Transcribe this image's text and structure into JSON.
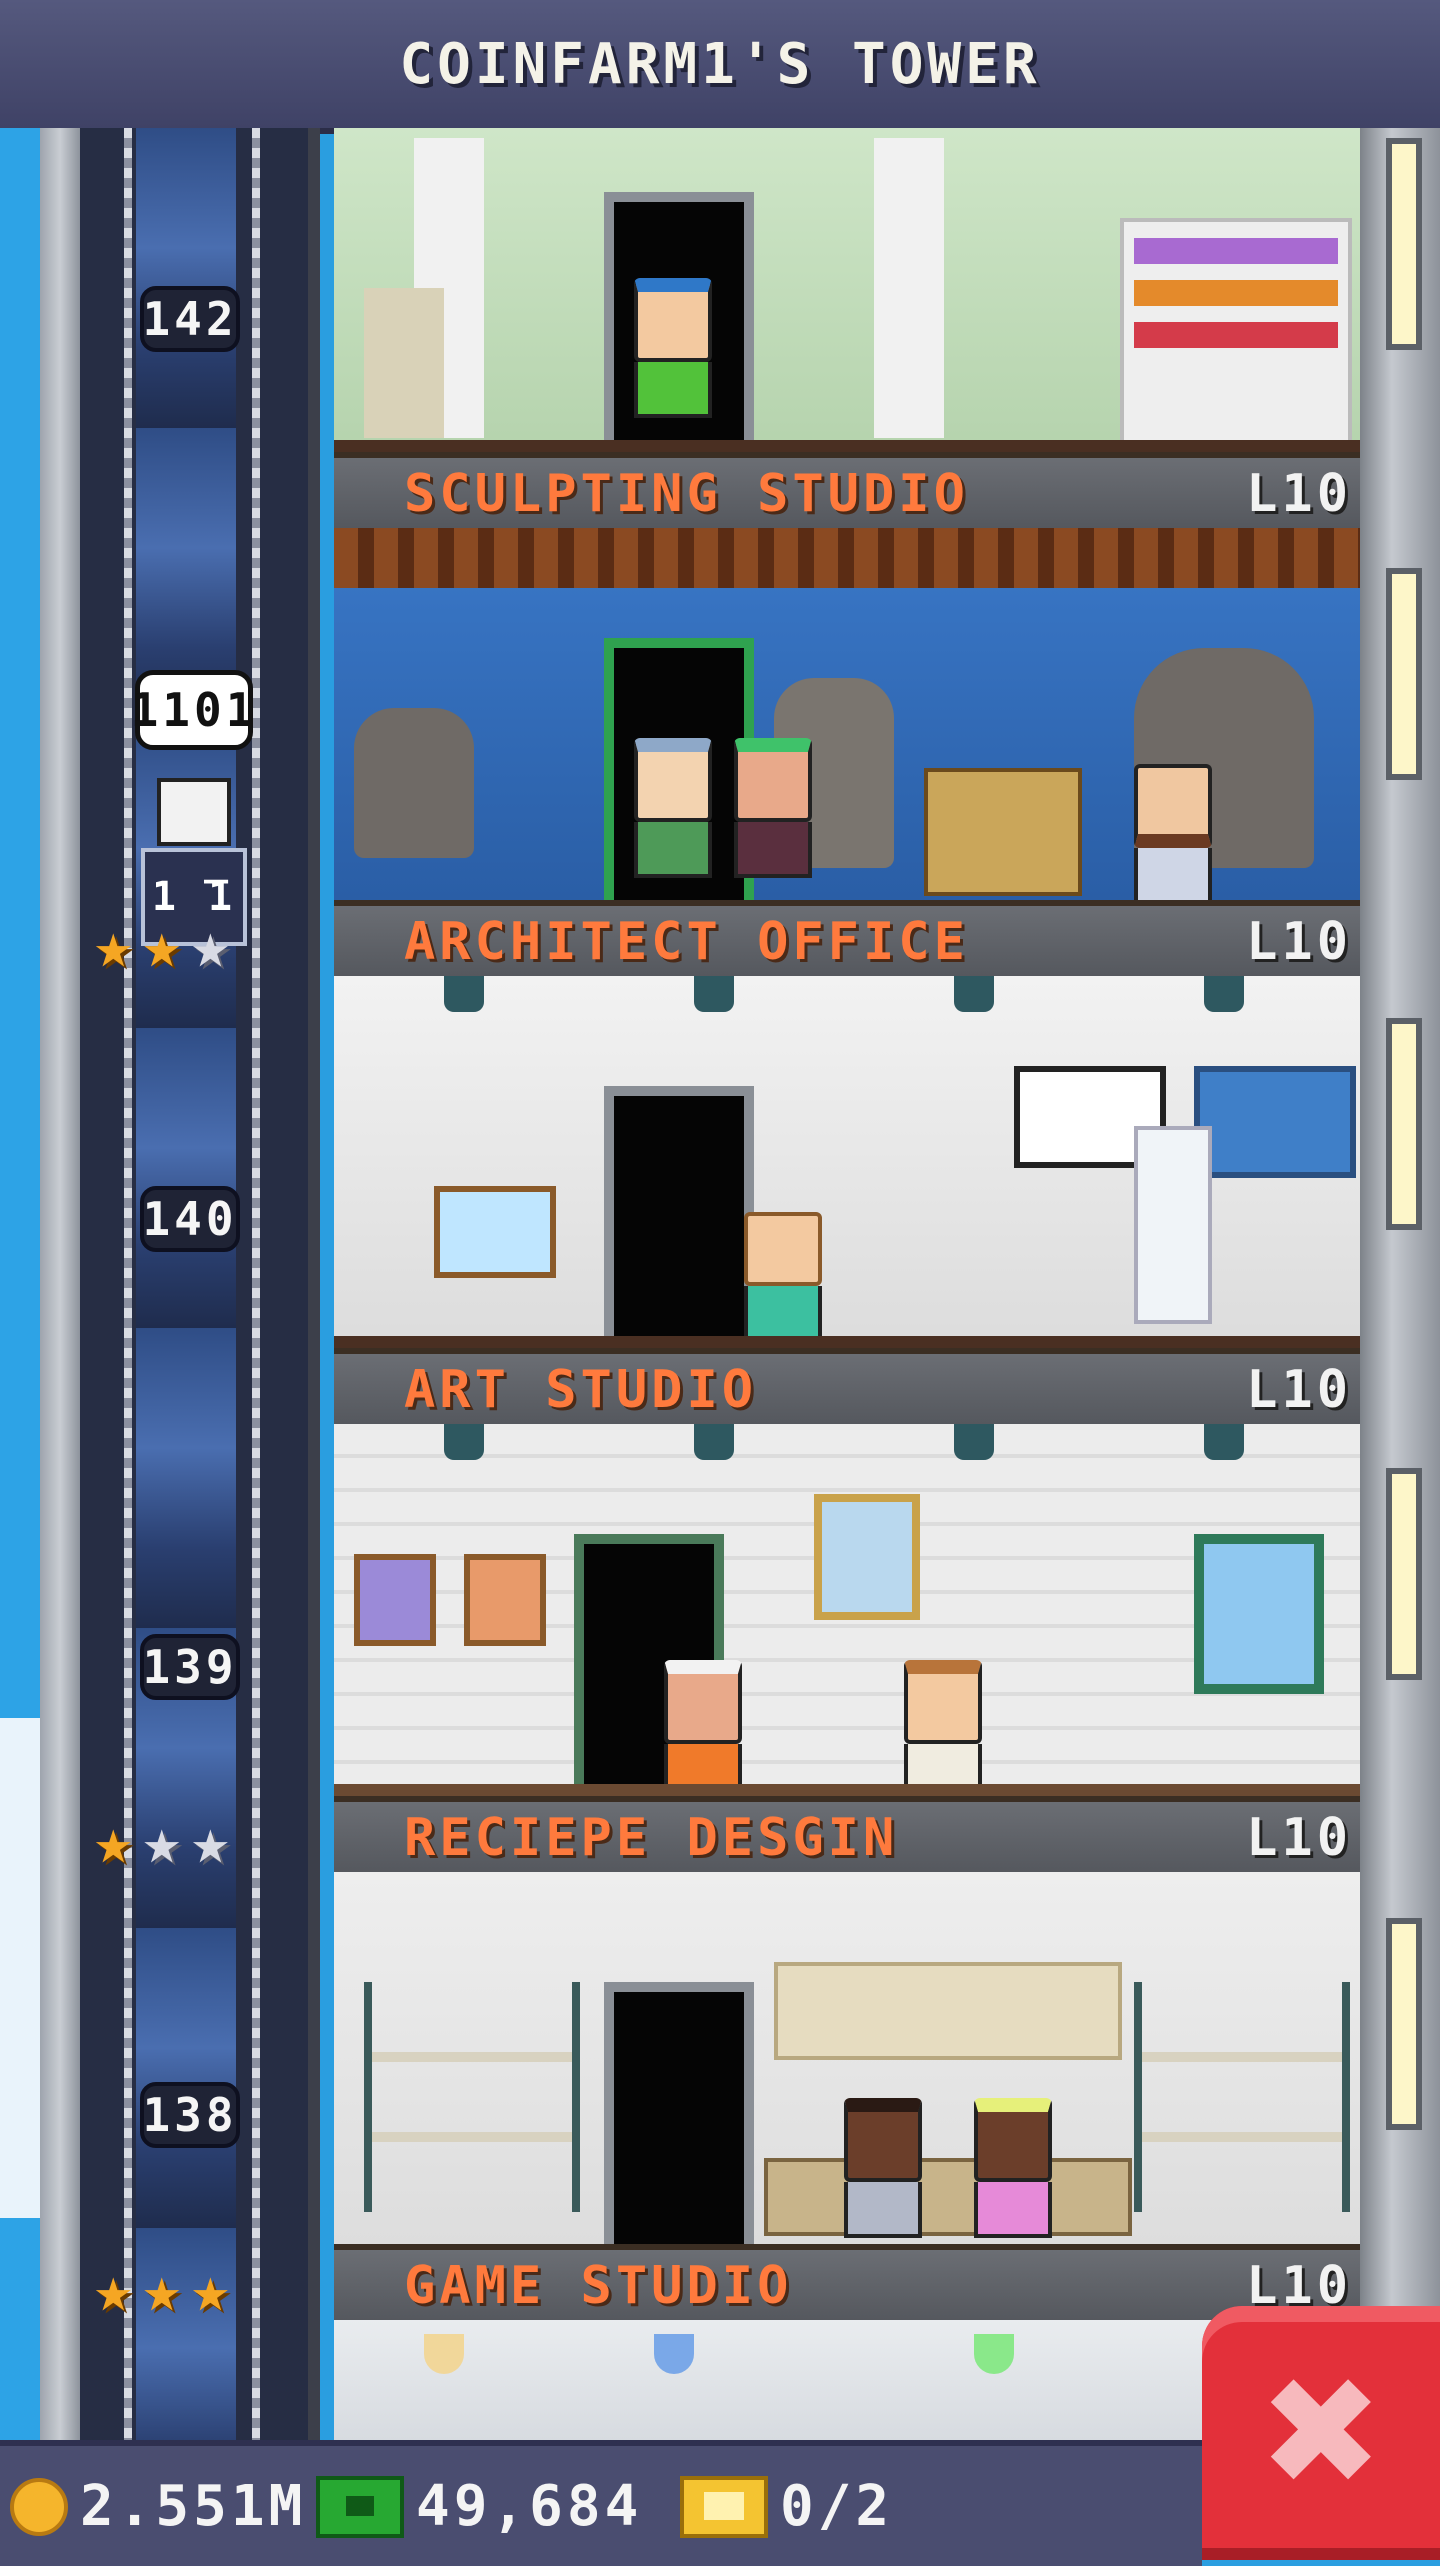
{
  "header": {
    "title": "COINFARM1'S TOWER"
  },
  "elevator": {
    "floor_numbers": [
      "142",
      "140",
      "139",
      "138"
    ],
    "car_bubble": "1101",
    "car_display": "1 ̅1"
  },
  "floors": [
    {
      "name": "SCULPTING STUDIO",
      "level": "L10",
      "stars": []
    },
    {
      "name": "ARCHITECT OFFICE",
      "level": "L10",
      "stars": [
        "gold",
        "gold",
        "silver"
      ]
    },
    {
      "name": "ART STUDIO",
      "level": "L10",
      "stars": []
    },
    {
      "name": "RECIEPE DESGIN",
      "level": "L10",
      "stars": [
        "gold",
        "silver",
        "silver"
      ]
    },
    {
      "name": "GAME STUDIO",
      "level": "L10",
      "stars": [
        "gold",
        "gold",
        "gold"
      ]
    }
  ],
  "status_bar": {
    "coins": "2.551M",
    "bux": "49,684",
    "tickets": "0/2"
  },
  "icons": {
    "coins": "coin-icon",
    "bux": "bux-icon",
    "tickets": "ticket-icon",
    "close": "close-icon",
    "star": "star-icon"
  },
  "colors": {
    "label_text": "#ff7a3d",
    "close_button": "#e3303a",
    "header_bg": "#4a4d70",
    "star_gold": "#f5a623",
    "star_silver": "#d9dbe4"
  }
}
